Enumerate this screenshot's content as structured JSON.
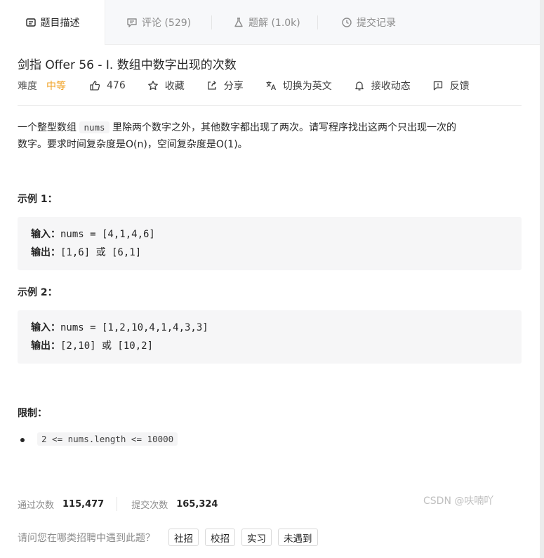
{
  "tabs": [
    {
      "label": "题目描述"
    },
    {
      "label": "评论 (529)"
    },
    {
      "label": "题解 (1.0k)"
    },
    {
      "label": "提交记录"
    }
  ],
  "problem": {
    "title": "剑指 Offer 56 - I. 数组中数字出现的次数",
    "difficulty_label": "难度",
    "difficulty": "中等",
    "likes": "476",
    "favorite": "收藏",
    "share": "分享",
    "switch_lang": "切换为英文",
    "notify": "接收动态",
    "feedback": "反馈"
  },
  "description": {
    "p1_before": "一个整型数组 ",
    "p1_code": "nums",
    "p1_after": " 里除两个数字之外，其他数字都出现了两次。请写程序找出这两个只出现一次的",
    "p2": "数字。要求时间复杂度是O(n)，空间复杂度是O(1)。"
  },
  "examples": [
    {
      "title": "示例 1：",
      "in_label": "输入：",
      "in_value": "nums = [4,1,4,6]",
      "out_label": "输出：",
      "out_value": "[1,6] 或 [6,1]"
    },
    {
      "title": "示例 2：",
      "in_label": "输入：",
      "in_value": "nums = [1,2,10,4,1,4,3,3]",
      "out_label": "输出：",
      "out_value": "[2,10] 或 [10,2]"
    }
  ],
  "limits": {
    "title": "限制：",
    "items": [
      "2 <= nums.length <= 10000"
    ]
  },
  "stats": {
    "accepted_label": "通过次数",
    "accepted_value": "115,477",
    "submitted_label": "提交次数",
    "submitted_value": "165,324"
  },
  "ask": {
    "question": "请问您在哪类招聘中遇到此题？",
    "options": [
      "社招",
      "校招",
      "实习",
      "未遇到"
    ]
  },
  "watermark": "CSDN @呋喃吖",
  "colors": {
    "difficulty": "#f0a020",
    "tab_bar": "#f7f8fa",
    "code_bg": "#f6f6f7"
  }
}
